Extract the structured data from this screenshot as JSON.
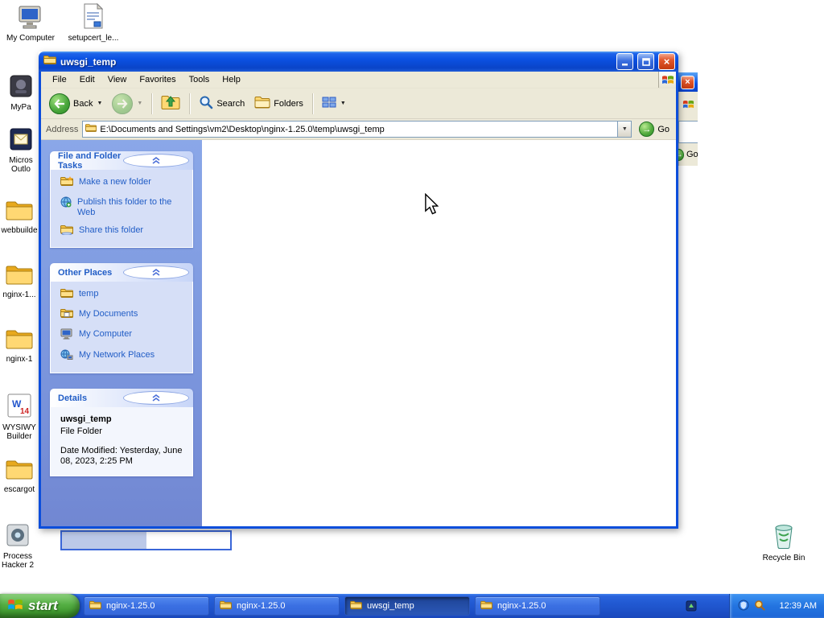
{
  "desktop": {
    "icons": [
      {
        "label": "My Computer",
        "icon": "my-computer-icon"
      },
      {
        "label": "setupcert_le...",
        "icon": "installer-document-icon"
      },
      {
        "label": "MyPa",
        "icon": "app-icon"
      },
      {
        "label": "Micros Outlo",
        "icon": "outlook-icon"
      },
      {
        "label": "webbuilde",
        "icon": "folder-icon"
      },
      {
        "label": "nginx-1...",
        "icon": "folder-icon"
      },
      {
        "label": "nginx-1",
        "icon": "folder-icon"
      },
      {
        "label": "WYSIWY Builder",
        "icon": "app-icon"
      },
      {
        "label": "escargot",
        "icon": "folder-icon"
      },
      {
        "label": "Process Hacker 2",
        "icon": "app-icon"
      }
    ],
    "recycle_bin_label": "Recycle Bin"
  },
  "explorer": {
    "title": "uwsgi_temp",
    "menu": [
      "File",
      "Edit",
      "View",
      "Favorites",
      "Tools",
      "Help"
    ],
    "toolbar": {
      "back_label": "Back",
      "search_label": "Search",
      "folders_label": "Folders"
    },
    "address_label": "Address",
    "address_value": "E:\\Documents and Settings\\vm2\\Desktop\\nginx-1.25.0\\temp\\uwsgi_temp",
    "go_label": "Go",
    "tasks_panel": {
      "title": "File and Folder Tasks",
      "items": [
        "Make a new folder",
        "Publish this folder to the Web",
        "Share this folder"
      ]
    },
    "places_panel": {
      "title": "Other Places",
      "items": [
        "temp",
        "My Documents",
        "My Computer",
        "My Network Places"
      ]
    },
    "details_panel": {
      "title": "Details",
      "name": "uwsgi_temp",
      "type": "File Folder",
      "modified": "Date Modified: Yesterday, June 08, 2023, 2:25 PM"
    }
  },
  "background_window": {
    "go_label": "Go"
  },
  "taskbar": {
    "start_label": "start",
    "buttons": [
      {
        "label": "nginx-1.25.0",
        "active": false
      },
      {
        "label": "nginx-1.25.0",
        "active": false
      },
      {
        "label": "uwsgi_temp",
        "active": true
      },
      {
        "label": "nginx-1.25.0",
        "active": false
      }
    ],
    "clock": "12:39 AM"
  },
  "colors": {
    "titlebar_blue": "#0B51E2",
    "window_chrome_beige": "#ECE9D8",
    "sidebar_blue": "#7C97DE",
    "panel_body_blue": "#D6DFF7",
    "panel_title_text": "#215DC6",
    "taskbar_blue": "#2159D2",
    "start_green": "#54AE43",
    "close_red": "#D6441A",
    "folder_yellow": "#F7C64A"
  },
  "icons": {
    "windows_flag": "windows-logo-icon",
    "magnifier": "search-icon",
    "folder": "folder-icon",
    "chevron_up": "collapse-chevron-icon"
  }
}
